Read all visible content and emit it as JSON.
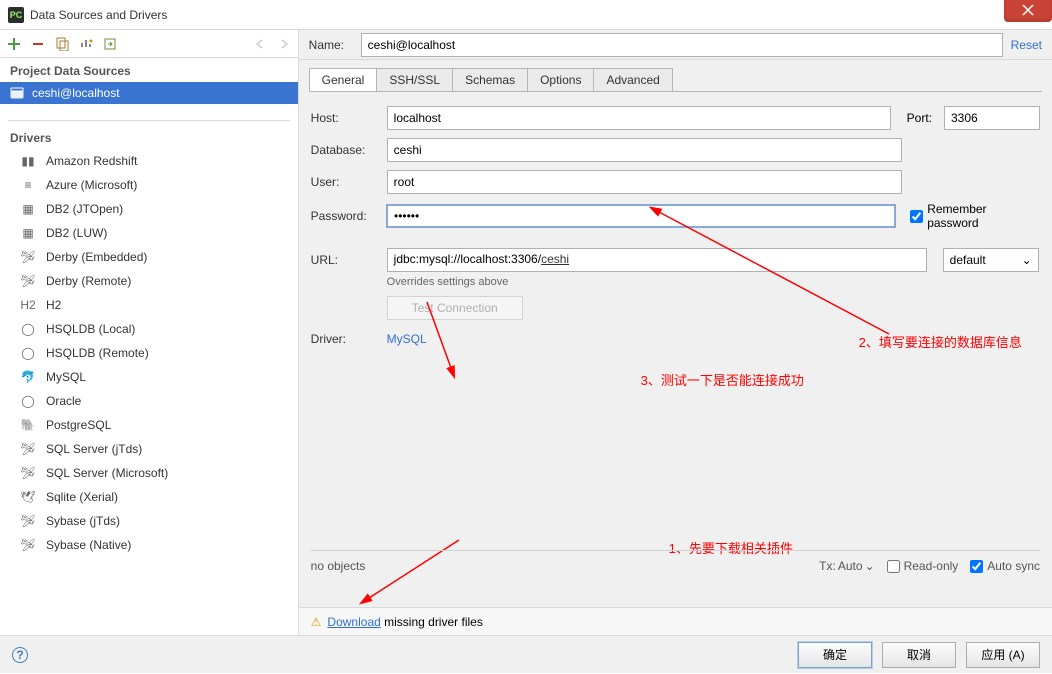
{
  "title": "Data Sources and Drivers",
  "sidebar": {
    "project_header": "Project Data Sources",
    "datasource": "ceshi@localhost",
    "drivers_header": "Drivers",
    "drivers": [
      "Amazon Redshift",
      "Azure (Microsoft)",
      "DB2 (JTOpen)",
      "DB2 (LUW)",
      "Derby (Embedded)",
      "Derby (Remote)",
      "H2",
      "HSQLDB (Local)",
      "HSQLDB (Remote)",
      "MySQL",
      "Oracle",
      "PostgreSQL",
      "SQL Server (jTds)",
      "SQL Server (Microsoft)",
      "Sqlite (Xerial)",
      "Sybase (jTds)",
      "Sybase (Native)"
    ]
  },
  "main": {
    "name_label": "Name:",
    "name_value": "ceshi@localhost",
    "reset": "Reset",
    "tabs": [
      "General",
      "SSH/SSL",
      "Schemas",
      "Options",
      "Advanced"
    ],
    "host_label": "Host:",
    "host_value": "localhost",
    "port_label": "Port:",
    "port_value": "3306",
    "database_label": "Database:",
    "database_value": "ceshi",
    "user_label": "User:",
    "user_value": "root",
    "password_label": "Password:",
    "password_value": "••••••",
    "remember_label": "Remember password",
    "url_label": "URL:",
    "url_prefix": "jdbc:mysql://localhost:3306/",
    "url_db": "ceshi",
    "overrides": "Overrides settings above",
    "default_option": "default",
    "test_btn": "Test Connection",
    "driver_label": "Driver:",
    "driver_link": "MySQL",
    "no_objects": "no objects",
    "tx_label": "Tx:",
    "tx_value": "Auto",
    "readonly_label": "Read-only",
    "autosync_label": "Auto sync",
    "download_link": "Download",
    "download_rest": " missing driver files"
  },
  "footer": {
    "ok": "确定",
    "cancel": "取消",
    "apply": "应用 (A)"
  },
  "annotations": {
    "a1": "1、先要下载相关插件",
    "a2": "2、填写要连接的数据库信息",
    "a3": "3、测试一下是否能连接成功"
  }
}
